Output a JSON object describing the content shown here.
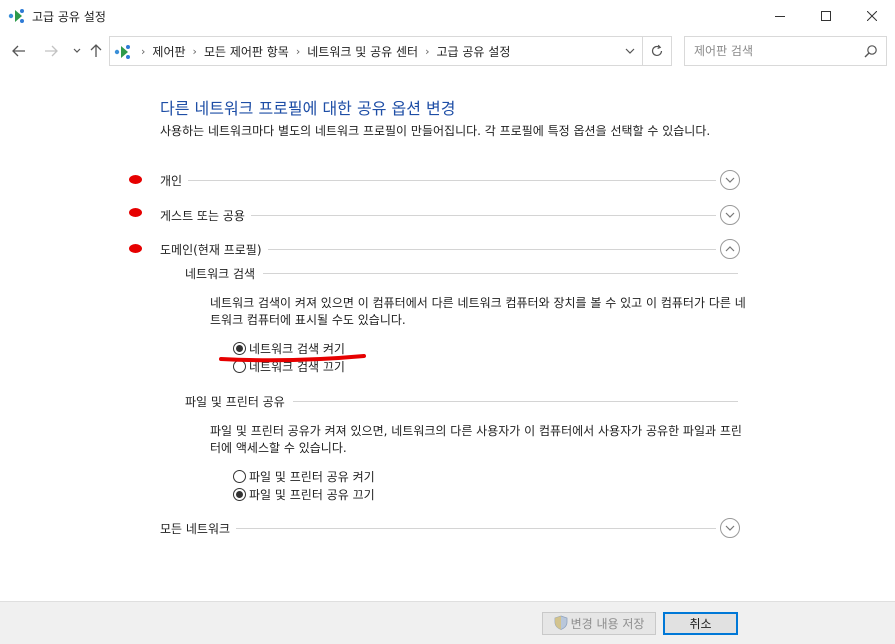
{
  "window": {
    "title": "고급 공유 설정"
  },
  "address_bar": {
    "crumbs": [
      "제어판",
      "모든 제어판 항목",
      "네트워크 및 공유 센터",
      "고급 공유 설정"
    ],
    "search_placeholder": "제어판 검색"
  },
  "main": {
    "heading": "다른 네트워크 프로필에 대한 공유 옵션 변경",
    "intro": "사용하는 네트워크마다 별도의 네트워크 프로필이 만들어집니다. 각 프로필에 특정 옵션을 선택할 수 있습니다.",
    "profiles": [
      {
        "label": "개인",
        "expanded": false
      },
      {
        "label": "게스트 또는 공용",
        "expanded": false
      },
      {
        "label": "도메인(현재 프로필)",
        "expanded": true
      },
      {
        "label": "모든 네트워크",
        "expanded": false
      }
    ],
    "network_discovery": {
      "title": "네트워크 검색",
      "description": "네트워크 검색이 켜져 있으면 이 컴퓨터에서 다른 네트워크 컴퓨터와 장치를 볼 수 있고 이 컴퓨터가 다른 네트워크 컴퓨터에 표시될 수도 있습니다.",
      "option_on": "네트워크 검색 켜기",
      "option_off": "네트워크 검색 끄기",
      "selected": "on"
    },
    "file_printer_sharing": {
      "title": "파일 및 프린터 공유",
      "description": "파일 및 프린터 공유가 켜져 있으면, 네트워크의 다른 사용자가 이 컴퓨터에서 사용자가 공유한 파일과 프린터에 액세스할 수 있습니다.",
      "option_on": "파일 및 프린터 공유 켜기",
      "option_off": "파일 및 프린터 공유 끄기",
      "selected": "off"
    }
  },
  "footer": {
    "save_label": "변경 내용 저장",
    "cancel_label": "취소"
  },
  "colors": {
    "heading": "#1e4ea6",
    "annotation": "#e60000",
    "focus_border": "#0078d7"
  }
}
